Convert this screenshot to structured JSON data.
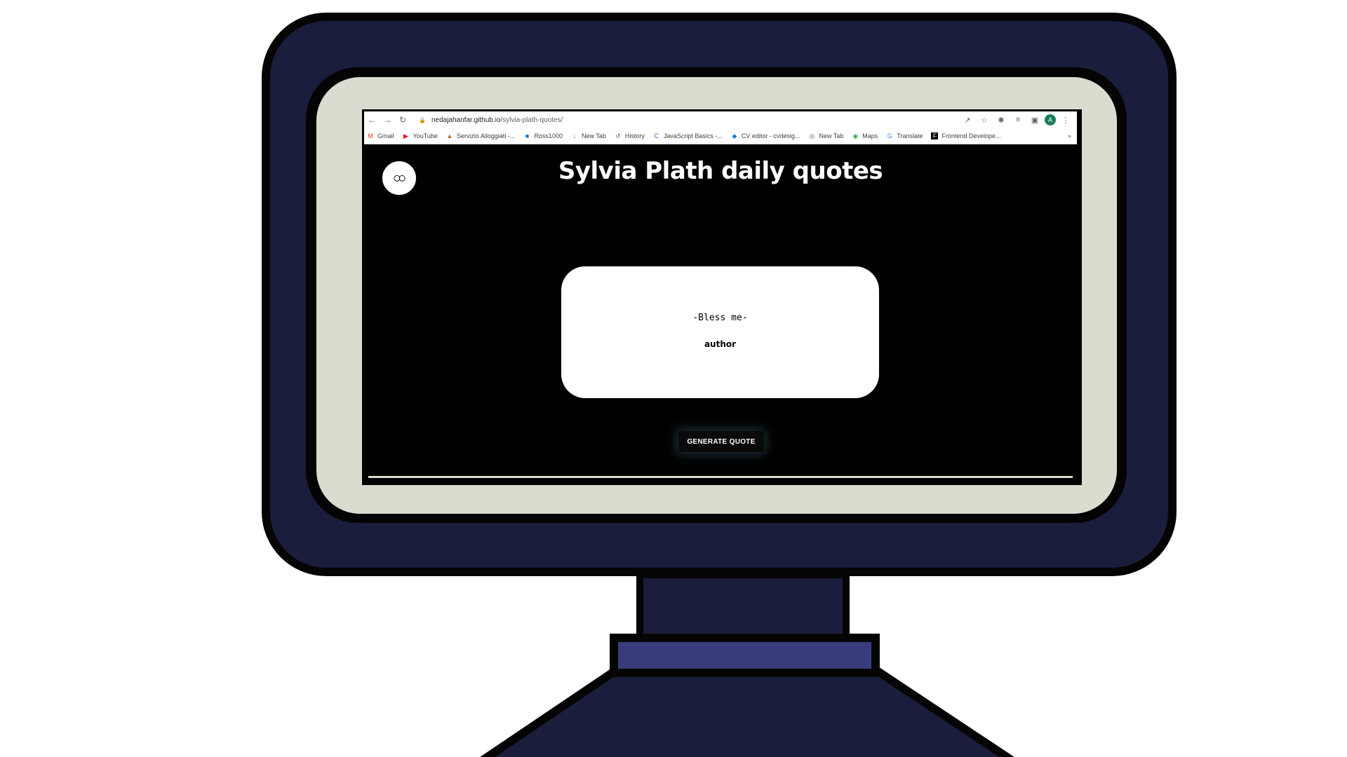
{
  "browser": {
    "url_host": "nedajahanfar.github.io",
    "url_path": "/sylvia-plath-quotes/",
    "profile_initial": "A",
    "bookmarks": [
      {
        "label": "Gmail",
        "icon": "gmail-icon",
        "color": "#ea4335"
      },
      {
        "label": "YouTube",
        "icon": "youtube-icon",
        "color": "#ff0000"
      },
      {
        "label": "Servizio Alloggiati -...",
        "icon": "servizio-icon",
        "color": "#b5651d"
      },
      {
        "label": "Ross1000",
        "icon": "ross-icon",
        "color": "#1a73e8"
      },
      {
        "label": "New Tab",
        "icon": "download-icon",
        "color": "#5f6368"
      },
      {
        "label": "History",
        "icon": "history-icon",
        "color": "#5f6368"
      },
      {
        "label": "JavaScript Basics -...",
        "icon": "c-icon",
        "color": "#1a73e8"
      },
      {
        "label": "CV editor - cvdesig...",
        "icon": "cv-icon",
        "color": "#1a73e8"
      },
      {
        "label": "New Tab",
        "icon": "globe-icon",
        "color": "#5f6368"
      },
      {
        "label": "Maps",
        "icon": "maps-icon",
        "color": "#34a853"
      },
      {
        "label": "Translate",
        "icon": "translate-icon",
        "color": "#4285f4"
      },
      {
        "label": "Frontend Develope...",
        "icon": "fm-icon",
        "color": "#000000"
      }
    ],
    "more_bookmarks": "»"
  },
  "page": {
    "title": "Sylvia Plath daily quotes",
    "quote": "-Bless me-",
    "author": "author",
    "button_label": "GENERATE QUOTE"
  },
  "colors": {
    "monitor_body": "#1b1d3c",
    "monitor_frame": "#dcdbcf",
    "stand_accent": "#383c7a"
  }
}
